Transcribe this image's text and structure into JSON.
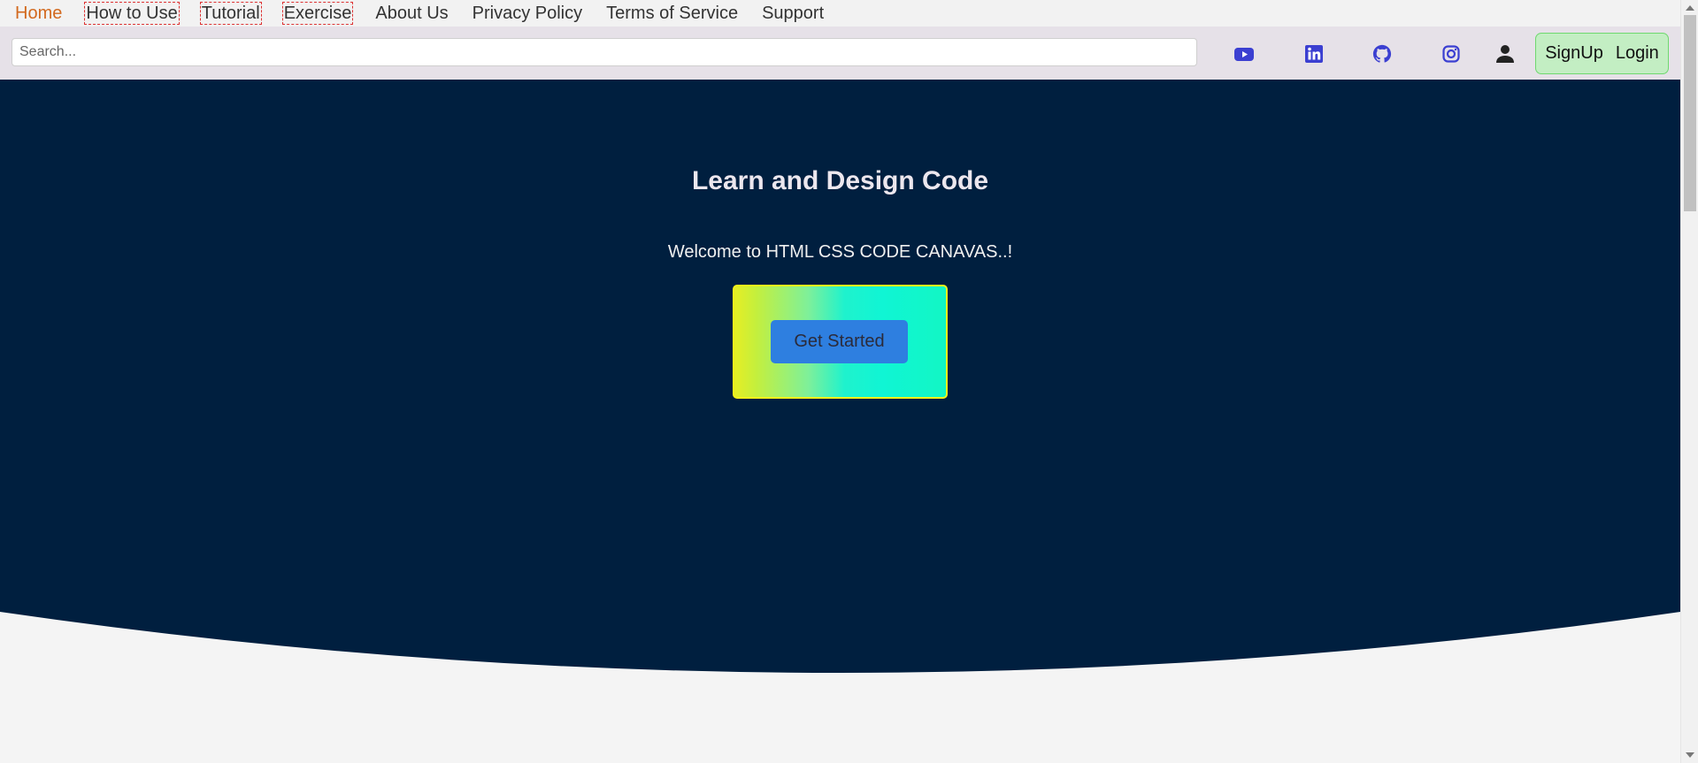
{
  "nav": {
    "items": [
      {
        "label": "Home",
        "active": true
      },
      {
        "label": "How to Use"
      },
      {
        "label": "Tutorial"
      },
      {
        "label": "Exercise"
      },
      {
        "label": "About Us"
      },
      {
        "label": "Privacy Policy"
      },
      {
        "label": "Terms of Service"
      },
      {
        "label": "Support"
      }
    ]
  },
  "search": {
    "placeholder": "Search...",
    "value": ""
  },
  "social": {
    "icons": [
      "youtube-icon",
      "linkedin-icon",
      "github-icon",
      "instagram-icon",
      "user-icon"
    ],
    "accent_color": "#3b3fd1"
  },
  "auth": {
    "signup_label": "SignUp",
    "login_label": "Login"
  },
  "hero": {
    "title": "Learn and Design Code",
    "subtitle": "Welcome to HTML CSS CODE CANAVAS..!",
    "cta_label": "Get Started",
    "background_color": "#001f3f"
  },
  "colors": {
    "active_nav": "#d2691e",
    "auth_bg": "#c3eec3",
    "cta_button": "#2e7fe0"
  }
}
